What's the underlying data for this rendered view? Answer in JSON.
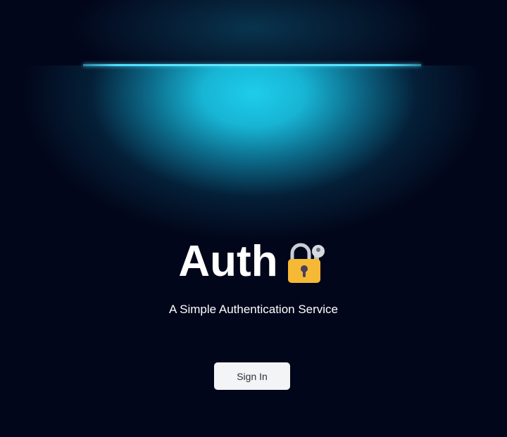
{
  "hero": {
    "title": "Auth",
    "title_icon": "locked-with-key-icon",
    "subtitle": "A Simple Authentication Service"
  },
  "actions": {
    "signin_label": "Sign In"
  },
  "colors": {
    "background": "#02061a",
    "glow": "#1ecdeb",
    "button_bg": "#f3f4f6",
    "lock_gold": "#f5b935"
  }
}
